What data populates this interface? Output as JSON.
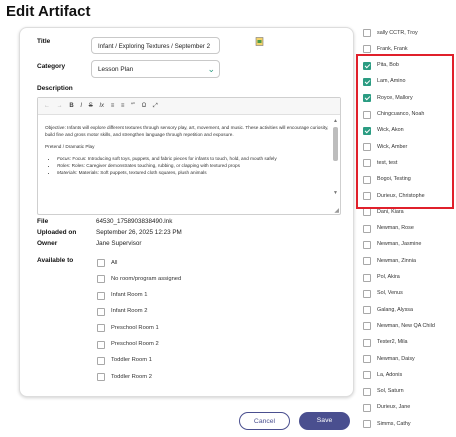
{
  "page_title": "Edit Artifact",
  "form": {
    "title_label": "Title",
    "title_value": "Infant / Exploring Textures / September 2",
    "category_label": "Category",
    "category_value": "Lesson Plan",
    "description_label": "Description",
    "toolbar": [
      "←",
      "→",
      "B",
      "I",
      "S",
      "Ix",
      "≡",
      "≡",
      "“”",
      "Ω",
      "⤢"
    ],
    "description": {
      "objective": "Objective: Infants will explore different textures through sensory play, art, movement, and music. These activities will encourage curiosity, build fine and gross motor skills, and strengthen language through repetition and exposure.",
      "section": "Pretend / Dramatic Play",
      "bullets": [
        "Focus: Introducing soft toys, puppets, and fabric pieces for infants to touch, hold, and mouth safely",
        "Roles: Caregiver demonstrates touching, rubbing, or clapping with textured props",
        "Materials: Soft puppets, textured cloth squares, plush animals"
      ]
    },
    "file_label": "File",
    "file_value": "64530_1758903838490.lnk",
    "uploaded_label": "Uploaded on",
    "uploaded_value": "September 26, 2025 12:23 PM",
    "owner_label": "Owner",
    "owner_value": "Jane Supervisor",
    "available_label": "Available to",
    "available_options": [
      {
        "label": "All",
        "checked": false
      },
      {
        "label": "No room/program assigned",
        "checked": false
      },
      {
        "label": "Infant Room 1",
        "checked": false
      },
      {
        "label": "Infant Room 2",
        "checked": false
      },
      {
        "label": "Preschool Room 1",
        "checked": false
      },
      {
        "label": "Preschool Room 2",
        "checked": false
      },
      {
        "label": "Toddler Room 1",
        "checked": false
      },
      {
        "label": "Toddler Room 2",
        "checked": false
      }
    ],
    "cancel_label": "Cancel",
    "save_label": "Save"
  },
  "people": [
    {
      "name": "sally CCTR, Troy",
      "checked": false
    },
    {
      "name": "Frank, Frank",
      "checked": false
    },
    {
      "name": "Pita, Bob",
      "checked": true
    },
    {
      "name": "Lam, Amino",
      "checked": true
    },
    {
      "name": "Royce, Mallory",
      "checked": true
    },
    {
      "name": "Chingcuanco, Noah",
      "checked": false
    },
    {
      "name": "Wick, Akon",
      "checked": true
    },
    {
      "name": "Wick, Amber",
      "checked": false
    },
    {
      "name": "test, test",
      "checked": false
    },
    {
      "name": "Bogoi, Testing",
      "checked": false
    },
    {
      "name": "Durieux, Christophe",
      "checked": false
    },
    {
      "name": "Dani, Kiara",
      "checked": false
    },
    {
      "name": "Newman, Rose",
      "checked": false
    },
    {
      "name": "Newman, Jasmine",
      "checked": false
    },
    {
      "name": "Newman, Zinnia",
      "checked": false
    },
    {
      "name": "Pol, Akira",
      "checked": false
    },
    {
      "name": "Sol, Venus",
      "checked": false
    },
    {
      "name": "Galang, Alyssa",
      "checked": false
    },
    {
      "name": "Newman, New QA Child",
      "checked": false
    },
    {
      "name": "Tester2, Mila",
      "checked": false
    },
    {
      "name": "Newman, Daisy",
      "checked": false
    },
    {
      "name": "La, Adonis",
      "checked": false
    },
    {
      "name": "Sol, Saturn",
      "checked": false
    },
    {
      "name": "Durieux, Jane",
      "checked": false
    },
    {
      "name": "Simms, Cathy",
      "checked": false
    }
  ],
  "colors": {
    "accent": "#2b9c82",
    "button": "#4a4f8f",
    "highlight": "#e0202b"
  }
}
